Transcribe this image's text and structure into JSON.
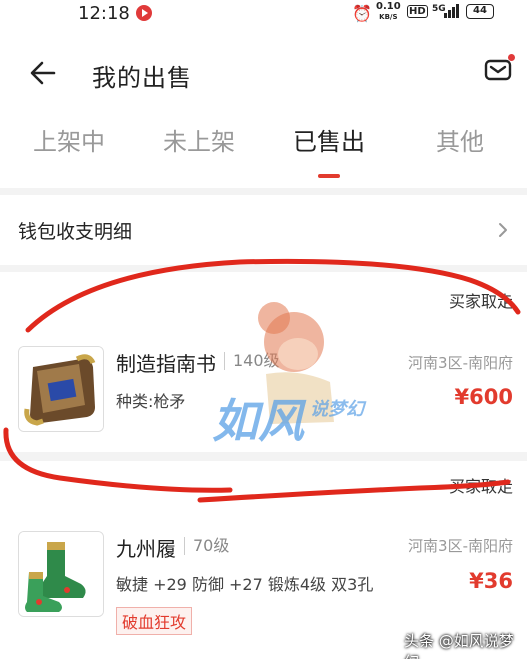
{
  "status_bar": {
    "time": "12:18",
    "net_speed": "0.10",
    "net_speed_unit": "KB/S",
    "hd": "HD",
    "signal_type": "5G",
    "battery": "44"
  },
  "header": {
    "title": "我的出售"
  },
  "tabs": [
    {
      "label": "上架中",
      "active": false
    },
    {
      "label": "未上架",
      "active": false
    },
    {
      "label": "已售出",
      "active": true
    },
    {
      "label": "其他",
      "active": false
    }
  ],
  "wallet": {
    "label": "钱包收支明细"
  },
  "orders": [
    {
      "status": "买家取走",
      "name": "制造指南书",
      "level": "140级",
      "server": "河南3区-南阳府",
      "attr": "种类:枪矛",
      "price": "¥600"
    },
    {
      "status": "买家取走",
      "name": "九州履",
      "level": "70级",
      "server": "河南3区-南阳府",
      "attr": "敏捷 +29 防御 +27 锻炼4级 双3孔",
      "price": "¥36",
      "tag": "破血狂攻"
    }
  ],
  "watermark": {
    "text_main": "如风",
    "text_sub": "说梦幻",
    "credit": "头条 @如风说梦幻"
  },
  "colors": {
    "accent": "#e23b2e",
    "background": "#f3f3f3"
  }
}
